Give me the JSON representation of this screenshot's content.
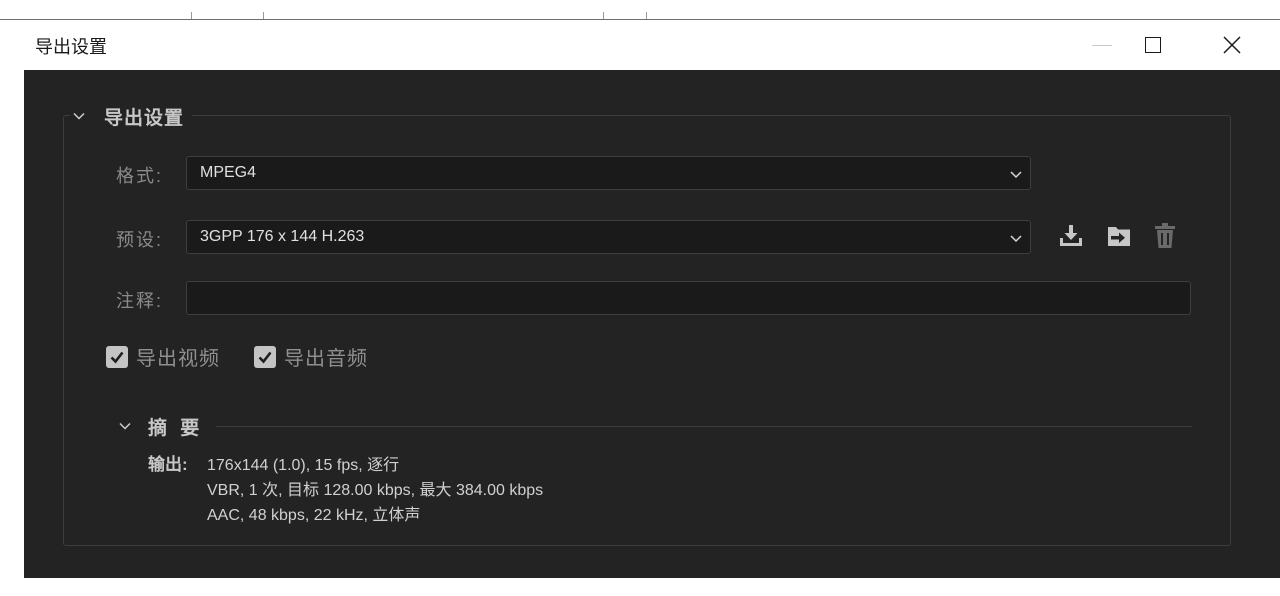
{
  "window": {
    "title": "导出设置"
  },
  "export_settings": {
    "section_title": "导出设置",
    "format": {
      "label": "格式:",
      "value": "MPEG4"
    },
    "preset": {
      "label": "预设:",
      "value": "3GPP 176 x 144 H.263"
    },
    "comment": {
      "label": "注释:",
      "value": ""
    },
    "export_video": {
      "label": "导出视频",
      "checked": true
    },
    "export_audio": {
      "label": "导出音频",
      "checked": true
    },
    "preset_actions": [
      "import-preset-icon",
      "save-preset-icon",
      "delete-preset-icon"
    ]
  },
  "summary": {
    "title": "摘 要",
    "output_label": "输出:",
    "lines": [
      "176x144 (1.0), 15 fps, 逐行",
      "VBR, 1 次, 目标 128.00 kbps, 最大 384.00 kbps",
      "AAC, 48 kbps, 22 kHz, 立体声"
    ]
  },
  "colors": {
    "panel_background": "#232323",
    "field_background": "#1a1a1a",
    "checkbox": "#c4c4c4"
  }
}
